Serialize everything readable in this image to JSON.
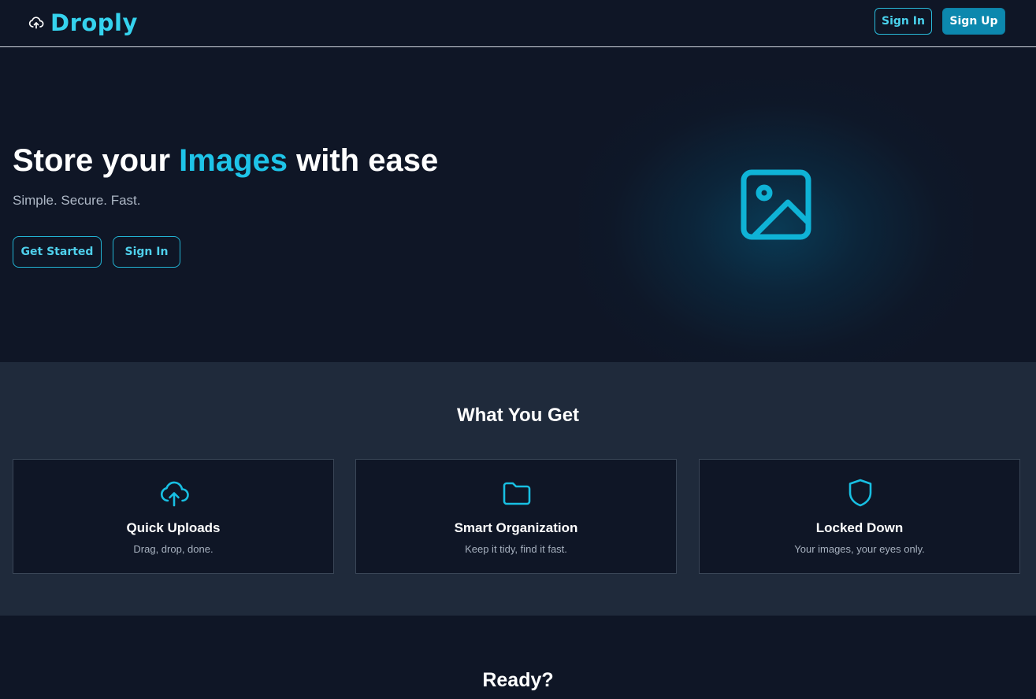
{
  "nav": {
    "brand": "Droply",
    "brand_icon": "cloud-upload-icon",
    "signin_label": "Sign In",
    "signup_label": "Sign Up"
  },
  "hero": {
    "title_pre": "Store your ",
    "title_accent": "Images",
    "title_post": " with ease",
    "subtitle": "Simple. Secure. Fast.",
    "get_started_label": "Get Started",
    "signin_label": "Sign In",
    "illustration_icon": "image-icon"
  },
  "features": {
    "title": "What You Get",
    "cards": [
      {
        "icon": "cloud-upload-icon",
        "title": "Quick Uploads",
        "desc": "Drag, drop, done."
      },
      {
        "icon": "folder-icon",
        "title": "Smart Organization",
        "desc": "Keep it tidy, find it fast."
      },
      {
        "icon": "shield-icon",
        "title": "Locked Down",
        "desc": "Your images, your eyes only."
      }
    ]
  },
  "cta": {
    "title": "Ready?"
  },
  "colors": {
    "background": "#0f1626",
    "section": "#1f2a3b",
    "accent": "#1ec4e8",
    "primary_button": "#0c88ae"
  }
}
